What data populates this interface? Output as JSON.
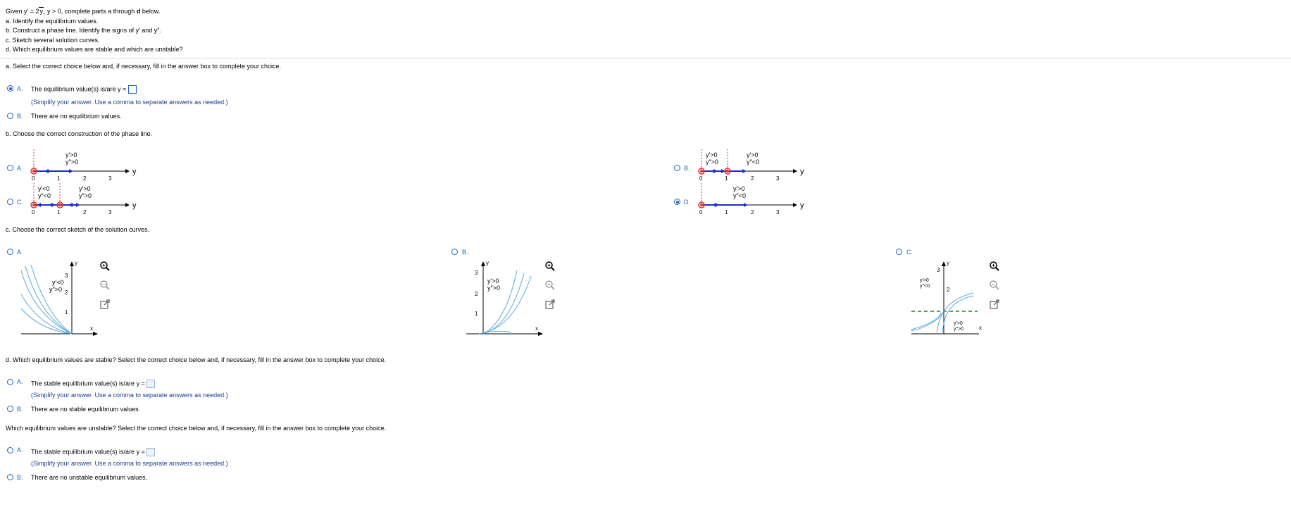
{
  "problem": {
    "given": "Given y′ = 2√y, y > 0, complete parts a through d below.",
    "given_prefix": "Given y′ = 2",
    "given_sqrt": "y",
    "given_suffix": ", y > 0, complete parts a through",
    "given_bold": "d",
    "given_end": "below.",
    "line_a": "a. Identify the equilibrium values.",
    "line_b": "b. Construct a phase line. Identify the signs of y′ and y″.",
    "line_c": "c. Sketch several solution curves.",
    "line_d": "d. Which equilibrium values are stable and which are unstable?"
  },
  "part_a": {
    "prompt": "a. Select the correct choice below and, if necessary, fill in the answer box to complete your choice.",
    "option_a_letter": "A.",
    "option_a_text": "The equilibrium value(s) is/are y =",
    "option_a_hint": "(Simplify your answer. Use a comma to separate answers as needed.)",
    "option_b_letter": "B.",
    "option_b_text": "There are no equilibrium values.",
    "selected": "A"
  },
  "part_b": {
    "prompt": "b. Choose the correct construction of the phase line.",
    "selected": "D",
    "options": [
      {
        "letter": "A.",
        "labels": [
          "y′>0",
          "y″>0"
        ]
      },
      {
        "letter": "B.",
        "labels": [
          "y′>0",
          "y″>0",
          "y′>0",
          "y″<0"
        ]
      },
      {
        "letter": "C.",
        "labels": [
          "y′<0",
          "y″<0",
          "y′>0",
          "y″>0"
        ]
      },
      {
        "letter": "D.",
        "labels": [
          "y′>0",
          "y″<0"
        ]
      }
    ],
    "axis_var": "y",
    "ticks": [
      "0",
      "1",
      "2",
      "3"
    ]
  },
  "part_c": {
    "prompt": "c. Choose the correct sketch of the solution curves.",
    "options": [
      {
        "letter": "A.",
        "labels": [
          "y′<0",
          "y″>0"
        ],
        "ticks": [
          "3",
          "2",
          "1"
        ]
      },
      {
        "letter": "B.",
        "labels": [
          "y′>0",
          "y″>0"
        ],
        "ticks": [
          "3",
          "2",
          "1"
        ]
      },
      {
        "letter": "C.",
        "labels": [
          "y′>0",
          "y″<0",
          "y′>0",
          "y″>0"
        ],
        "ticks": [
          "3",
          "2"
        ]
      }
    ],
    "axis_x": "x",
    "axis_y": "y"
  },
  "part_d": {
    "prompt": "d. Which equilibrium values are stable? Select the correct choice below and, if necessary, fill in the answer box to complete your choice.",
    "option_a_letter": "A.",
    "option_a_text": "The stable equilibrium value(s) is/are y =",
    "option_a_hint": "(Simplify your answer. Use a comma to separate answers as needed.)",
    "option_b_letter": "B.",
    "option_b_text": "There are no stable equilibrium values.",
    "prompt2": "Which equilibrium values are unstable? Select the correct choice below and, if necessary, fill in the answer box to complete your choice.",
    "option2_a_letter": "A.",
    "option2_a_text": "The stable equilibrium value(s) is/are y =",
    "option2_a_hint": "(Simplify your answer. Use a comma to separate answers as needed.)",
    "option2_b_letter": "B.",
    "option2_b_text": "There are no unstable equilibrium values."
  },
  "icons": [
    "zoom-in-icon",
    "zoom-out-icon",
    "popout-icon"
  ],
  "colors": {
    "accent": "#1b61c9",
    "curve": "#5aa9e6",
    "equilibrium": "#e03030",
    "dashed": "#138a13"
  }
}
